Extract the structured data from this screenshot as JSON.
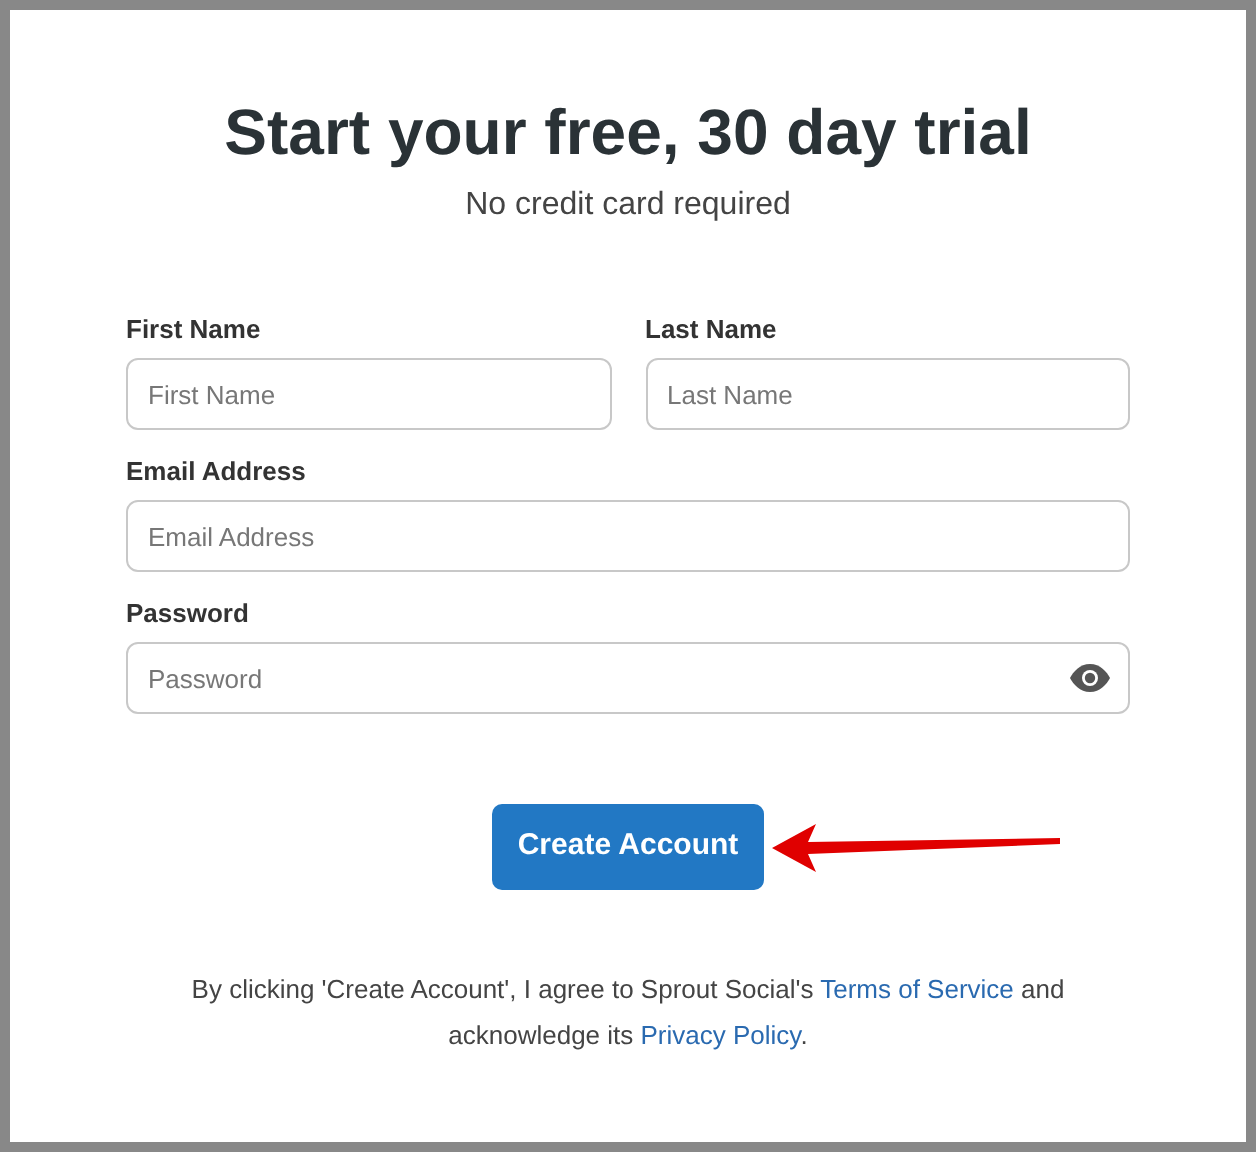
{
  "heading": "Start your free, 30 day trial",
  "subheading": "No credit card required",
  "name_fields": [
    {
      "label": "First Name",
      "placeholder": "First Name"
    },
    {
      "label": "Last Name",
      "placeholder": "Last Name"
    }
  ],
  "email": {
    "label": "Email Address",
    "placeholder": "Email Address"
  },
  "password": {
    "label": "Password",
    "placeholder": "Password"
  },
  "submit_button": "Create Account",
  "footer": {
    "text_before": "By clicking 'Create Account', I agree to Sprout Social's ",
    "terms_link": "Terms of Service",
    "text_middle": " and acknowledge its ",
    "privacy_link": "Privacy Policy",
    "text_after": "."
  }
}
